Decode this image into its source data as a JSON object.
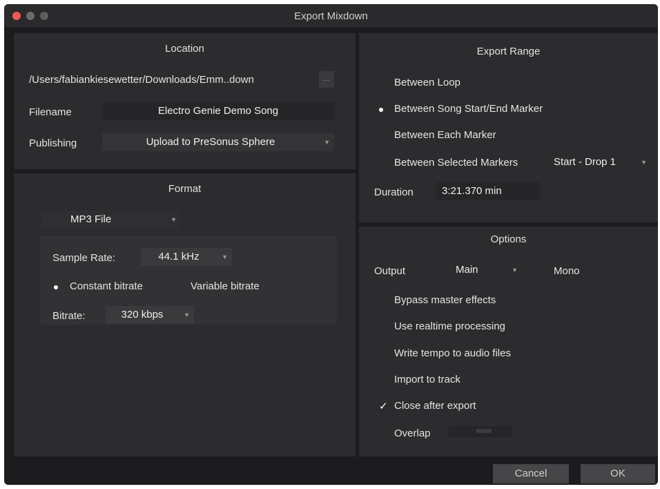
{
  "window": {
    "title": "Export Mixdown"
  },
  "location": {
    "heading": "Location",
    "path": "/Users/fabiankiesewetter/Downloads/Emm..down",
    "browse_label": "...",
    "filename_label": "Filename",
    "filename_value": "Electro Genie Demo Song",
    "publishing_label": "Publishing",
    "publishing_value": "Upload to PreSonus Sphere"
  },
  "format": {
    "heading": "Format",
    "file_type": "MP3 File",
    "sample_rate_label": "Sample Rate:",
    "sample_rate_value": "44.1 kHz",
    "constant_bitrate_label": "Constant bitrate",
    "variable_bitrate_label": "Variable bitrate",
    "bitrate_mode_selected": "constant",
    "bitrate_label": "Bitrate:",
    "bitrate_value": "320 kbps"
  },
  "export_range": {
    "heading": "Export Range",
    "options": [
      {
        "label": "Between Loop",
        "selected": false
      },
      {
        "label": "Between Song Start/End Marker",
        "selected": true
      },
      {
        "label": "Between Each Marker",
        "selected": false
      },
      {
        "label": "Between Selected Markers",
        "selected": false
      }
    ],
    "selected_markers_value": "Start - Drop 1",
    "duration_label": "Duration",
    "duration_value": "3:21.370 min"
  },
  "options": {
    "heading": "Options",
    "output_label": "Output",
    "output_value": "Main",
    "mono_label": "Mono",
    "mono_checked": false,
    "checkboxes": [
      {
        "label": "Bypass master effects",
        "checked": false
      },
      {
        "label": "Use realtime processing",
        "checked": false
      },
      {
        "label": "Write tempo to audio files",
        "checked": false
      },
      {
        "label": "Import to track",
        "checked": false
      },
      {
        "label": "Close after export",
        "checked": true
      }
    ],
    "overlap_label": "Overlap"
  },
  "footer": {
    "cancel_label": "Cancel",
    "ok_label": "OK"
  }
}
